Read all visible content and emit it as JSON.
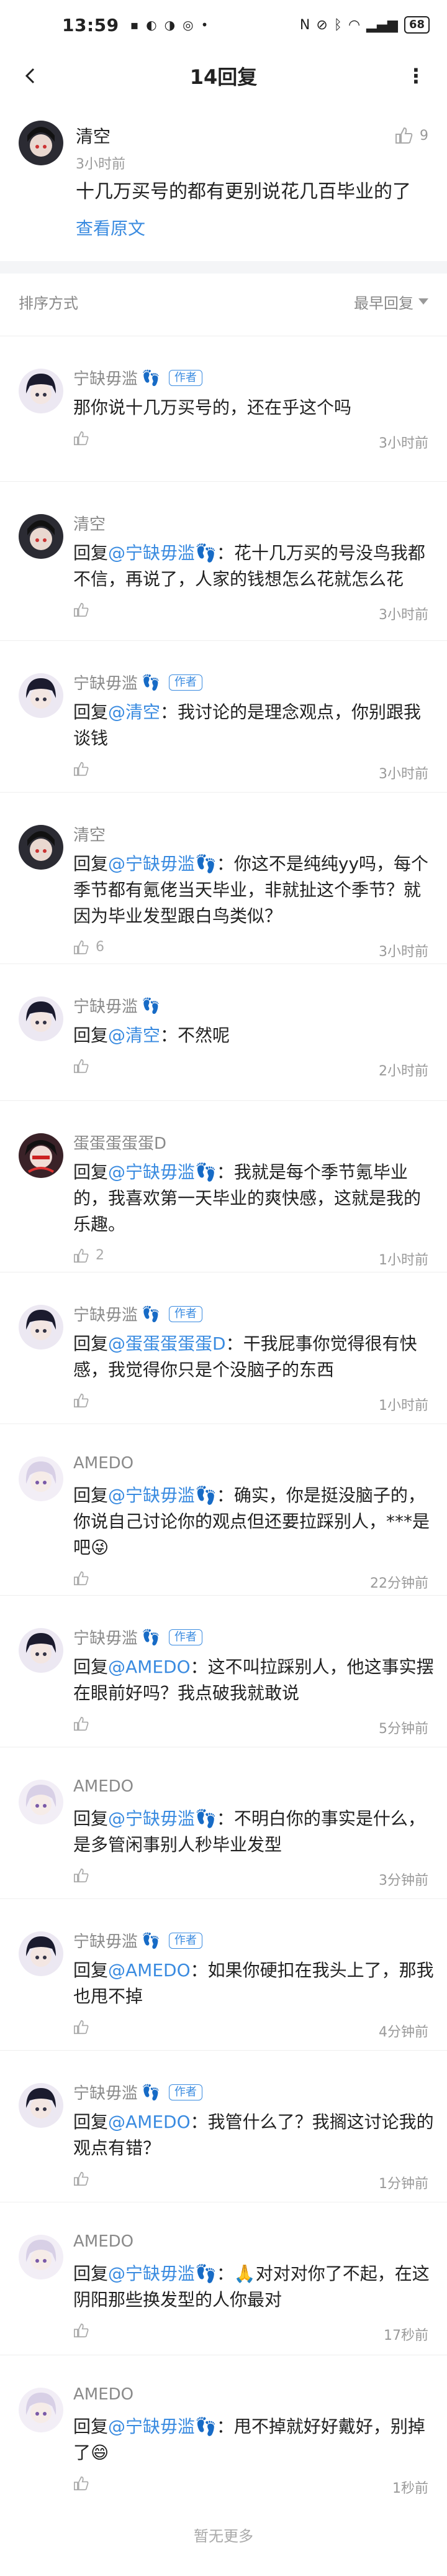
{
  "status_bar": {
    "time": "13:59",
    "battery": "68"
  },
  "nav": {
    "title": "14回复"
  },
  "main_post": {
    "author": "清空",
    "time": "3小时前",
    "likes": "9",
    "content": "十几万买号的都有更别说花几百毕业的了",
    "view_original": "查看原文"
  },
  "sort": {
    "label": "排序方式",
    "value": "最早回复"
  },
  "author_tag": "作者",
  "replies": [
    {
      "name": "宁缺毋滥",
      "feet": true,
      "author": true,
      "prefix": "",
      "at": "",
      "text": "那你说十几万买号的，还在乎这个吗",
      "likes": "",
      "time": "3小时前"
    },
    {
      "name": "清空",
      "feet": false,
      "author": false,
      "prefix": "回复",
      "at": "@宁缺毋滥👣",
      "text": "：花十几万买的号没鸟我都不信，再说了，人家的钱想怎么花就怎么花",
      "likes": "",
      "time": "3小时前"
    },
    {
      "name": "宁缺毋滥",
      "feet": true,
      "author": true,
      "prefix": "回复",
      "at": "@清空",
      "text": "：我讨论的是理念观点，你别跟我谈钱",
      "likes": "",
      "time": "3小时前"
    },
    {
      "name": "清空",
      "feet": false,
      "author": false,
      "prefix": "回复",
      "at": "@宁缺毋滥👣",
      "text": "：你这不是纯纯yy吗，每个季节都有氪佬当天毕业，非就扯这个季节？就因为毕业发型跟白鸟类似？",
      "likes": "6",
      "time": "3小时前"
    },
    {
      "name": "宁缺毋滥",
      "feet": true,
      "author": false,
      "prefix": "回复",
      "at": "@清空",
      "text": "：不然呢",
      "likes": "",
      "time": "2小时前"
    },
    {
      "name": "蛋蛋蛋蛋蛋D",
      "feet": false,
      "author": false,
      "prefix": "回复",
      "at": "@宁缺毋滥👣",
      "text": "：我就是每个季节氪毕业的，我喜欢第一天毕业的爽快感，这就是我的乐趣。",
      "likes": "2",
      "time": "1小时前"
    },
    {
      "name": "宁缺毋滥",
      "feet": true,
      "author": true,
      "prefix": "回复",
      "at": "@蛋蛋蛋蛋蛋D",
      "text": "：干我屁事你觉得很有快感，我觉得你只是个没脑子的东西",
      "likes": "",
      "time": "1小时前"
    },
    {
      "name": "AMEDO",
      "feet": false,
      "author": false,
      "prefix": "回复",
      "at": "@宁缺毋滥👣",
      "text": "：确实，你是挺没脑子的，你说自己讨论你的观点但还要拉踩别人，***是吧😜",
      "likes": "",
      "time": "22分钟前"
    },
    {
      "name": "宁缺毋滥",
      "feet": true,
      "author": true,
      "prefix": "回复",
      "at": "@AMEDO",
      "text": "：这不叫拉踩别人，他这事实摆在眼前好吗？我点破我就敢说",
      "likes": "",
      "time": "5分钟前"
    },
    {
      "name": "AMEDO",
      "feet": false,
      "author": false,
      "prefix": "回复",
      "at": "@宁缺毋滥👣",
      "text": "：不明白你的事实是什么，是多管闲事别人秒毕业发型",
      "likes": "",
      "time": "3分钟前"
    },
    {
      "name": "宁缺毋滥",
      "feet": true,
      "author": true,
      "prefix": "回复",
      "at": "@AMEDO",
      "text": "：如果你硬扣在我头上了，那我也甩不掉",
      "likes": "",
      "time": "4分钟前"
    },
    {
      "name": "宁缺毋滥",
      "feet": true,
      "author": true,
      "prefix": "回复",
      "at": "@AMEDO",
      "text": "：我管什么了？我搁这讨论我的观点有错？",
      "likes": "",
      "time": "1分钟前"
    },
    {
      "name": "AMEDO",
      "feet": false,
      "author": false,
      "prefix": "回复",
      "at": "@宁缺毋滥👣",
      "text": "：🙏对对对你了不起，在这阴阳那些换发型的人你最对",
      "likes": "",
      "time": "17秒前"
    },
    {
      "name": "AMEDO",
      "feet": false,
      "author": false,
      "prefix": "回复",
      "at": "@宁缺毋滥👣",
      "text": "：甩不掉就好好戴好，别掉了😄",
      "likes": "",
      "time": "1秒前"
    }
  ],
  "footer": {
    "no_more": "暂无更多"
  },
  "colors": {
    "link": "#3a8be0",
    "muted": "#999999",
    "divider": "#f4f5f7"
  }
}
